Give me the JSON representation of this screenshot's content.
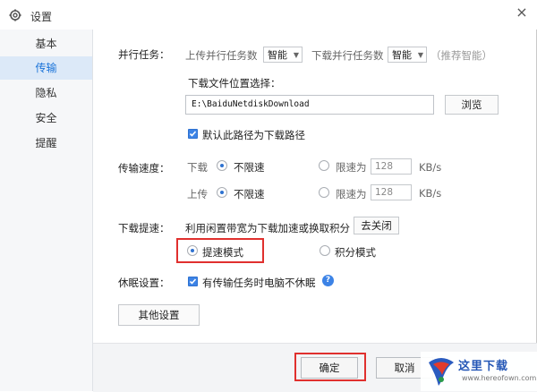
{
  "window": {
    "title": "设置",
    "close_glyph": "×"
  },
  "sidebar": {
    "items": [
      {
        "label": "基本",
        "active": false
      },
      {
        "label": "传输",
        "active": true
      },
      {
        "label": "隐私",
        "active": false
      },
      {
        "label": "安全",
        "active": false
      },
      {
        "label": "提醒",
        "active": false
      }
    ]
  },
  "parallel": {
    "label": "并行任务：",
    "upload_label": "上传并行任务数",
    "upload_value": "智能",
    "download_label": "下载并行任务数",
    "download_value": "智能",
    "hint": "（推荐智能）"
  },
  "download_location": {
    "label": "下载文件位置选择：",
    "path": "E:\\BaiduNetdiskDownload",
    "browse_label": "浏览",
    "default_checkbox_label": "默认此路径为下载路径",
    "default_checked": true
  },
  "speed": {
    "label": "传输速度：",
    "download_label": "下载",
    "upload_label": "上传",
    "unlimited_label": "不限速",
    "limit_label": "限速为",
    "download_limit_value": "128",
    "upload_limit_value": "128",
    "unit": "KB/s"
  },
  "boost": {
    "label": "下载提速：",
    "description": "利用闲置带宽为下载加速或换取积分",
    "toggle_label": "去关闭",
    "speed_mode_label": "提速模式",
    "points_mode_label": "积分模式"
  },
  "sleep": {
    "label": "休眠设置：",
    "checkbox_label": "有传输任务时电脑不休眠",
    "checked": true,
    "help_glyph": "?"
  },
  "other_settings_label": "其他设置",
  "footer": {
    "confirm_label": "确定",
    "cancel_label": "取消"
  },
  "watermark": {
    "title": "这里下载",
    "subtitle": "www.hereofown.com"
  },
  "colors": {
    "accent": "#3c83e6",
    "highlight_box": "#e0302e",
    "sidebar_active_bg": "#dce9f8"
  }
}
